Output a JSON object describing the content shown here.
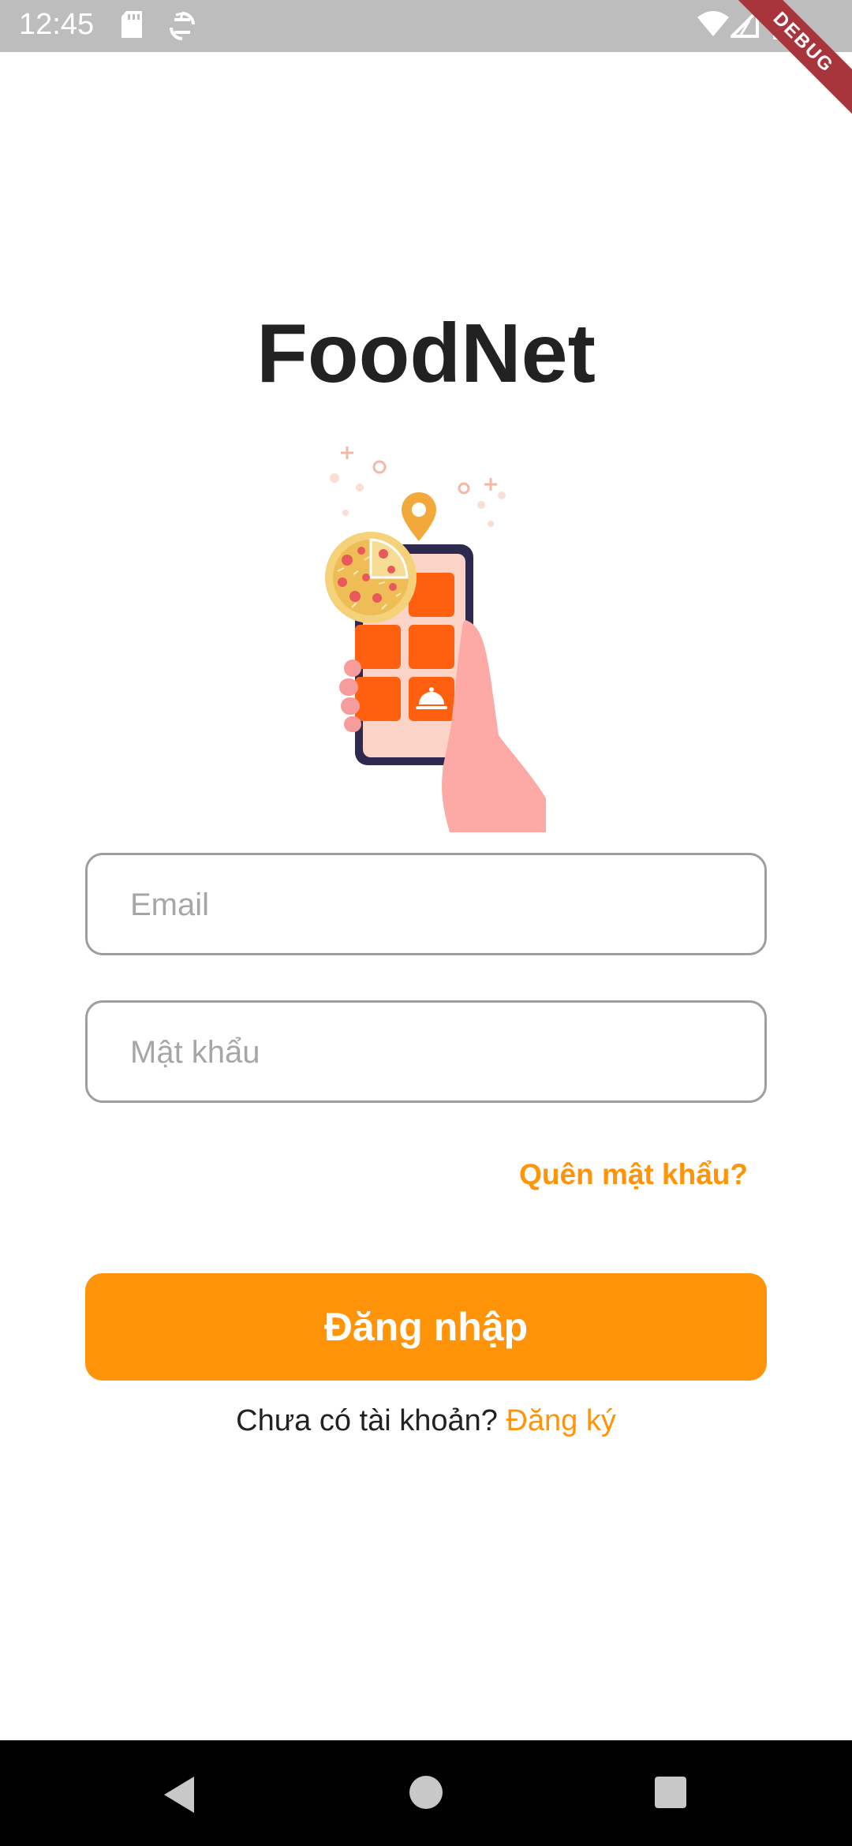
{
  "status_bar": {
    "time": "12:45",
    "icons": [
      "sd-card-icon",
      "sync-icon",
      "wifi-icon",
      "signal-icon",
      "battery-icon"
    ]
  },
  "debug_banner": "DEBUG",
  "login": {
    "title": "FoodNet",
    "email_placeholder": "Email",
    "email_value": "",
    "password_placeholder": "Mật khẩu",
    "password_value": "",
    "forgot_password": "Quên mật khẩu?",
    "login_button": "Đăng nhập",
    "no_account_text": "Chưa có tài khoản?",
    "signup_link": "Đăng ký"
  },
  "nav_bar": {
    "buttons": [
      "back-icon",
      "home-icon",
      "recents-icon"
    ]
  },
  "colors": {
    "accent": "#ff9408",
    "tile": "#ff6010",
    "status_bar": "#bdbdbd",
    "nav_bar": "#000000",
    "title": "#222222",
    "debug_ribbon": "#a8353c"
  }
}
